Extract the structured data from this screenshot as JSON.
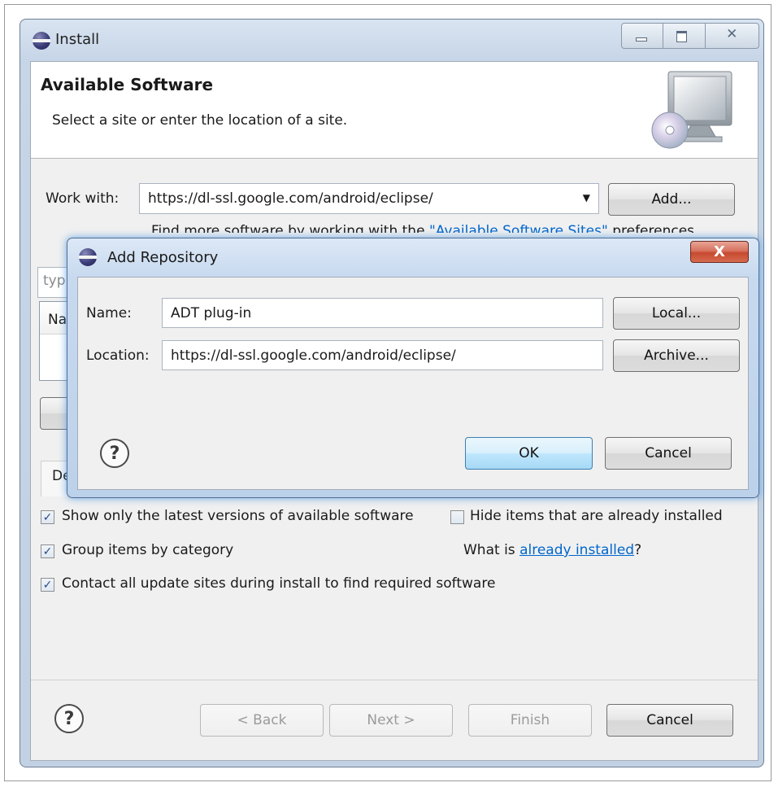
{
  "install_window": {
    "title": "Install",
    "icon": "eclipse-globe-icon",
    "banner_title": "Available Software",
    "banner_desc": "Select a site or enter the location of a site.",
    "work_with_label": "Work with:",
    "work_with_value": "https://dl-ssl.google.com/android/eclipse/",
    "add_button": "Add...",
    "find_more_prefix": "Find more software by working with the ",
    "find_more_link": "\"Available Software Sites\"",
    "find_more_suffix": " preferences",
    "filter_partial": "typ",
    "name_col_partial": "Na",
    "details_partial": "De",
    "checkboxes": {
      "show_latest": "Show only the latest versions of available software",
      "hide_installed": "Hide items that are already installed",
      "group_by_category": "Group items by category",
      "contact_all_sites": "Contact all update sites during install to find required software"
    },
    "what_is_prefix": "What is ",
    "what_is_link": "already installed",
    "what_is_suffix": "?",
    "buttons": {
      "help": "?",
      "back": "< Back",
      "next": "Next >",
      "finish": "Finish",
      "cancel": "Cancel"
    }
  },
  "add_repository": {
    "title": "Add Repository",
    "close": "X",
    "name_label": "Name:",
    "name_value": "ADT plug-in",
    "location_label": "Location:",
    "location_value": "https://dl-ssl.google.com/android/eclipse/",
    "local_button": "Local...",
    "archive_button": "Archive...",
    "help": "?",
    "ok_button": "OK",
    "cancel_button": "Cancel"
  },
  "colors": {
    "link": "#0066cc",
    "close_button": "#c74a2f",
    "default_button": "#a7d9f5"
  }
}
